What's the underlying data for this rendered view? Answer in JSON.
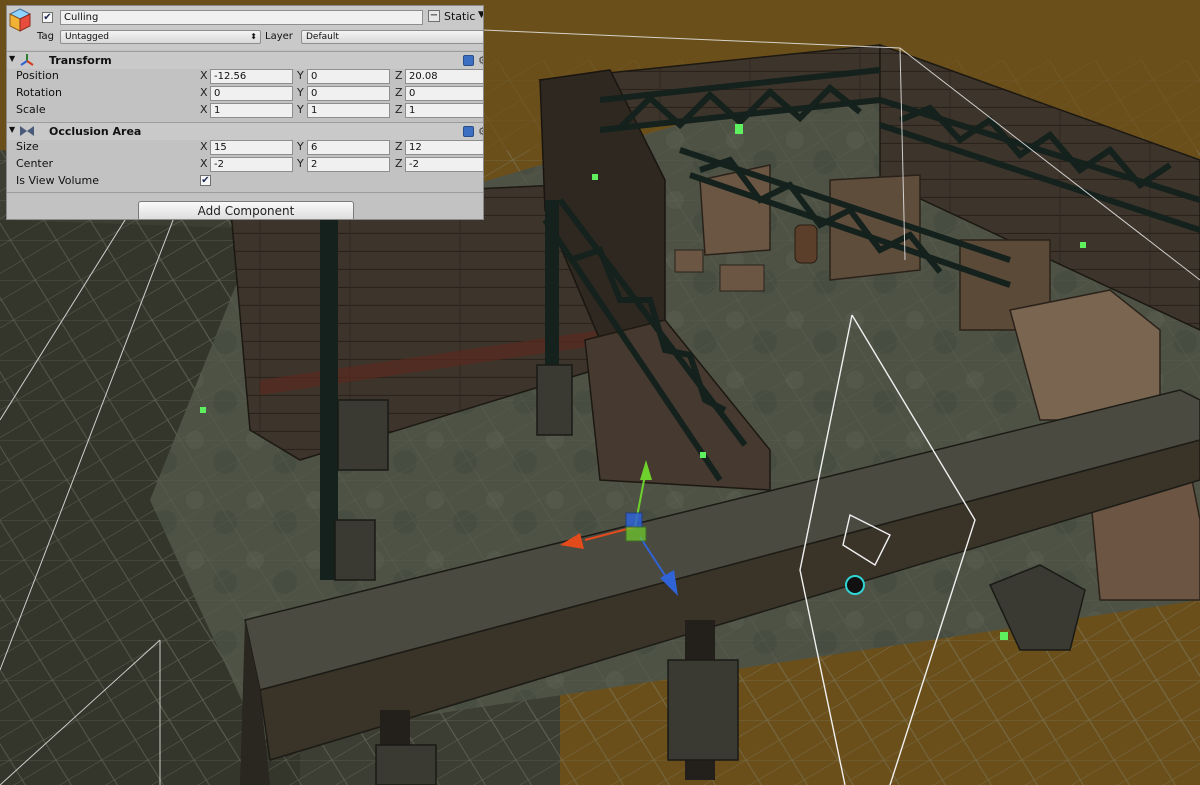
{
  "inspector": {
    "object_name": "Culling",
    "active_checked": true,
    "static_label": "Static",
    "tag_label": "Tag",
    "tag_value": "Untagged",
    "layer_label": "Layer",
    "layer_value": "Default"
  },
  "transform": {
    "title": "Transform",
    "rows": [
      {
        "label": "Position",
        "x": "-12.56",
        "y": "0",
        "z": "20.08"
      },
      {
        "label": "Rotation",
        "x": "0",
        "y": "0",
        "z": "0"
      },
      {
        "label": "Scale",
        "x": "1",
        "y": "1",
        "z": "1"
      }
    ]
  },
  "occlusion_area": {
    "title": "Occlusion Area",
    "size": {
      "label": "Size",
      "x": "15",
      "y": "6",
      "z": "12"
    },
    "center": {
      "label": "Center",
      "x": "-2",
      "y": "2",
      "z": "-2"
    },
    "view_volume_label": "Is View Volume",
    "view_volume_checked": true
  },
  "axis_labels": {
    "x": "X",
    "y": "Y",
    "z": "Z"
  },
  "add_component_label": "Add Component",
  "icons": [
    "cube-icon",
    "transform-axes-icon",
    "occlusion-area-icon",
    "help-icon",
    "gear-icon",
    "checkmark-icon",
    "dropdown-arrow-icon",
    "move-gizmo-icon"
  ],
  "colors": {
    "inspector_bg": "#c2c2c2",
    "floor": "#4b4f42",
    "ground_orange": "#6b4f1a",
    "wall": "#3b332a",
    "gizmo_x": "#e34a1c",
    "gizmo_y": "#6fd12b",
    "gizmo_z": "#2f63d6"
  }
}
